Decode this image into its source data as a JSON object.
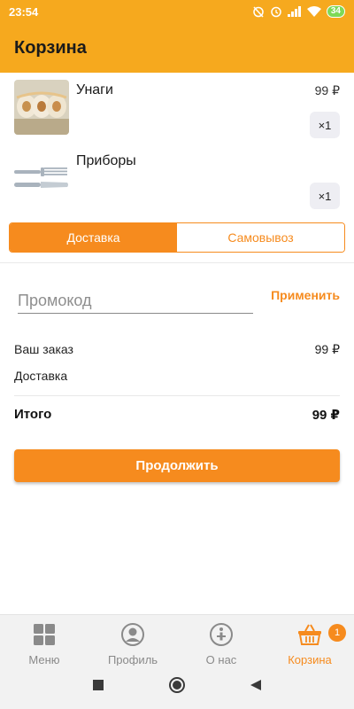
{
  "status_bar": {
    "time": "23:54",
    "battery": "34",
    "icons": [
      "alarm-off-icon",
      "alarm-icon",
      "signal-icon",
      "wifi-icon",
      "battery-icon"
    ]
  },
  "app_bar": {
    "title": "Корзина"
  },
  "cart_items": [
    {
      "name": "Унаги",
      "price": "99 ₽",
      "quantity": "×1",
      "icon": "sushi-roll-image"
    },
    {
      "name": "Приборы",
      "price": "",
      "quantity": "×1",
      "icon": "cutlery-image"
    }
  ],
  "delivery_toggle": {
    "options": [
      {
        "label": "Доставка",
        "selected": true
      },
      {
        "label": "Самовывоз",
        "selected": false
      }
    ]
  },
  "promo": {
    "placeholder": "Промокод",
    "value": "",
    "apply_label": "Применить"
  },
  "summary": {
    "order_label": "Ваш заказ",
    "order_value": "99 ₽",
    "delivery_label": "Доставка",
    "delivery_value": "",
    "total_label": "Итого",
    "total_value": "99 ₽"
  },
  "continue_label": "Продолжить",
  "bottom_nav": {
    "items": [
      {
        "label": "Меню",
        "icon": "menu-grid-icon",
        "active": false
      },
      {
        "label": "Профиль",
        "icon": "profile-icon",
        "active": false
      },
      {
        "label": "О нас",
        "icon": "info-icon",
        "active": false
      },
      {
        "label": "Корзина",
        "icon": "basket-icon",
        "active": true
      }
    ],
    "cart_badge": "1"
  },
  "colors": {
    "accent": "#f68b1e",
    "header": "#f6a91e",
    "nav_inactive": "#8a8a8a"
  }
}
